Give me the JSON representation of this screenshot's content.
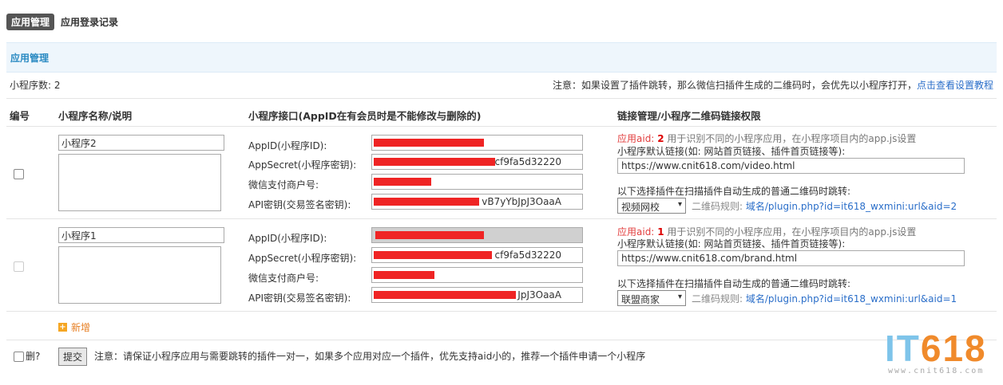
{
  "tabs": [
    {
      "label": "应用管理",
      "active": true
    },
    {
      "label": "应用登录记录",
      "active": false
    }
  ],
  "section": {
    "title": "应用管理"
  },
  "summary": {
    "count_label": "小程序数: 2",
    "notice": "注意：如果设置了插件跳转，那么微信扫插件生成的二维码时，会优先以小程序打开，",
    "notice_link": "点击查看设置教程"
  },
  "columns": [
    "编号",
    "小程序名称/说明",
    "小程序接口(AppID在有会员时是不能修改与删除的)",
    "链接管理/小程序二维码链接权限"
  ],
  "field_labels": {
    "appid": "AppID(小程序ID):",
    "secret": "AppSecret(小程序密钥):",
    "mch": "微信支付商户号:",
    "apikey": "API密钥(交易签名密钥):"
  },
  "rows": [
    {
      "name": "小程序2",
      "aid_prefix": "应用aid:",
      "aid": "2",
      "aid_desc": "用于识别不同的小程序应用，在小程序项目内的app.js设置",
      "default_link_label": "小程序默认链接(如: 网站首页链接、插件首页链接等):",
      "default_link": "https://www.cnit618.com/video.html",
      "plugin_label": "以下选择插件在扫描插件自动生成的普通二维码时跳转:",
      "plugin": "视频网校",
      "rule_label": "二维码规则:",
      "rule_link": "域名/plugin.php?id=it618_wxmini:url&aid=2",
      "secret_tail": "cf9fa5d32220",
      "apikey_tail": "vB7yYbJpJ3OaaA"
    },
    {
      "name": "小程序1",
      "aid_prefix": "应用aid:",
      "aid": "1",
      "aid_desc": "用于识别不同的小程序应用，在小程序项目内的app.js设置",
      "default_link_label": "小程序默认链接(如: 网站首页链接、插件首页链接等):",
      "default_link": "https://www.cnit618.com/brand.html",
      "plugin_label": "以下选择插件在扫描插件自动生成的普通二维码时跳转:",
      "plugin": "联盟商家",
      "rule_label": "二维码规则:",
      "rule_link": "域名/plugin.php?id=it618_wxmini:url&aid=1",
      "secret_tail": "cf9fa5d32220",
      "apikey_tail": "JpJ3OaaA"
    }
  ],
  "add_label": "新增",
  "footer": {
    "delete_label": "删?",
    "submit_label": "提交",
    "note": "注意：请保证小程序应用与需要跳转的插件一对一，如果多个应用对应一个插件，优先支持aid小的，推荐一个插件申请一个小程序"
  },
  "watermark": {
    "brand_letters": "IT",
    "brand_digits": "618",
    "site": "www.cnit618.com"
  },
  "colors": {
    "accent": "#2a8ac2",
    "link": "#2a6ec9",
    "redaction": "#ef2424",
    "aid_red": "#e23d3d"
  }
}
